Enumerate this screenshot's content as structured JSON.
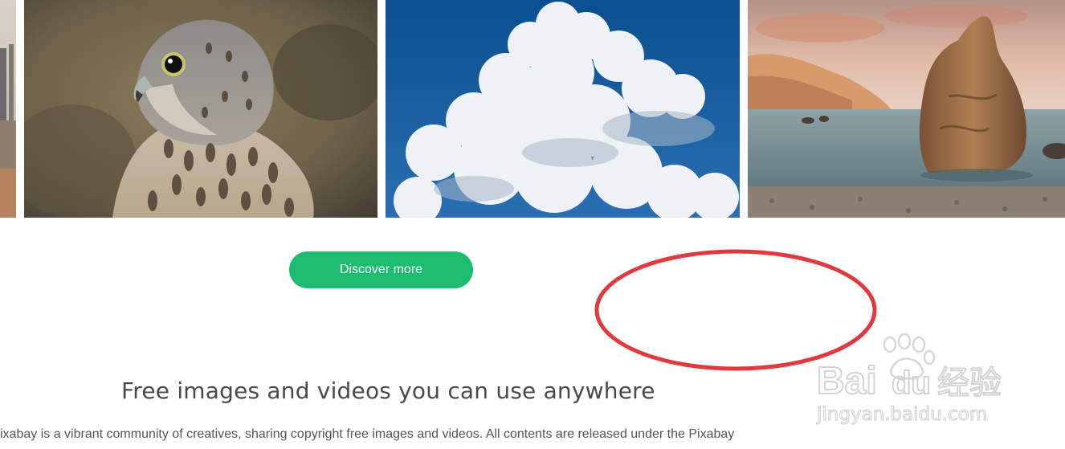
{
  "gallery": {
    "images": [
      {
        "subject": "city skyline edge",
        "interactable": true
      },
      {
        "subject": "kestrel bird portrait",
        "interactable": true
      },
      {
        "subject": "cumulus cloud in blue sky",
        "interactable": true
      },
      {
        "subject": "sea stack rock at shore",
        "interactable": true
      }
    ]
  },
  "actions": {
    "discover_label": "Discover more"
  },
  "annotation": {
    "shape": "ellipse",
    "color": "#e03a3e"
  },
  "content": {
    "headline": "Free images and videos you can use anywhere",
    "intro": "ixabay is a vibrant community of creatives, sharing copyright free images and videos. All contents are released under the Pixabay"
  },
  "watermark": {
    "brand_latin_1": "Bai",
    "brand_latin_2": "du",
    "brand_cn": "经验",
    "url": "jingyan.baidu.com"
  },
  "colors": {
    "accent": "#1cbd6e",
    "headline": "#4a4a4a",
    "body_text": "#555555",
    "annotation": "#e03a3e"
  }
}
